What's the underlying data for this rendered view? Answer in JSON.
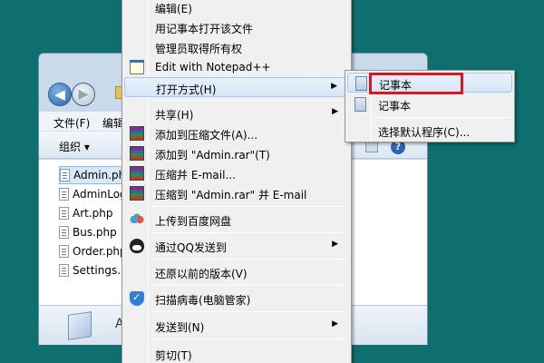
{
  "explorer": {
    "menubar": {
      "file": "文件(F)",
      "edit": "编辑"
    },
    "toolbar": {
      "organize": "组织 ▾"
    },
    "files": [
      "Admin.php",
      "AdminLogin.php",
      "Art.php",
      "Bus.php",
      "Order.php",
      "Settings.php"
    ],
    "details_initial": "A"
  },
  "context_menu": {
    "items": [
      {
        "label": "编辑(E)"
      },
      {
        "label": "用记事本打开该文件"
      },
      {
        "label": "管理员取得所有权"
      },
      {
        "label": "Edit with Notepad++",
        "icon": "notepad-plus-icon"
      },
      {
        "label": "打开方式(H)",
        "submenu": true
      },
      {
        "label": "共享(H)",
        "submenu": true
      },
      {
        "label": "添加到压缩文件(A)...",
        "icon": "winrar-icon"
      },
      {
        "label": "添加到 \"Admin.rar\"(T)",
        "icon": "winrar-icon"
      },
      {
        "label": "压缩并 E-mail...",
        "icon": "winrar-icon"
      },
      {
        "label": "压缩到 \"Admin.rar\" 并 E-mail",
        "icon": "winrar-icon"
      },
      {
        "label": "上传到百度网盘",
        "icon": "baidu-netdisk-icon"
      },
      {
        "label": "通过QQ发送到",
        "icon": "qq-icon",
        "submenu": true
      },
      {
        "label": "还原以前的版本(V)"
      },
      {
        "label": "扫描病毒(电脑管家)",
        "icon": "shield-icon"
      },
      {
        "label": "发送到(N)",
        "submenu": true
      },
      {
        "label": "剪切(T)"
      }
    ]
  },
  "open_with_submenu": {
    "items": [
      {
        "label": "记事本",
        "icon": "notepad-icon"
      },
      {
        "label": "记事本",
        "icon": "notepad-icon"
      },
      {
        "label": "选择默认程序(C)..."
      }
    ]
  },
  "colors": {
    "desktop": "#0f6e6e",
    "highlight_box": "#e0141e"
  }
}
